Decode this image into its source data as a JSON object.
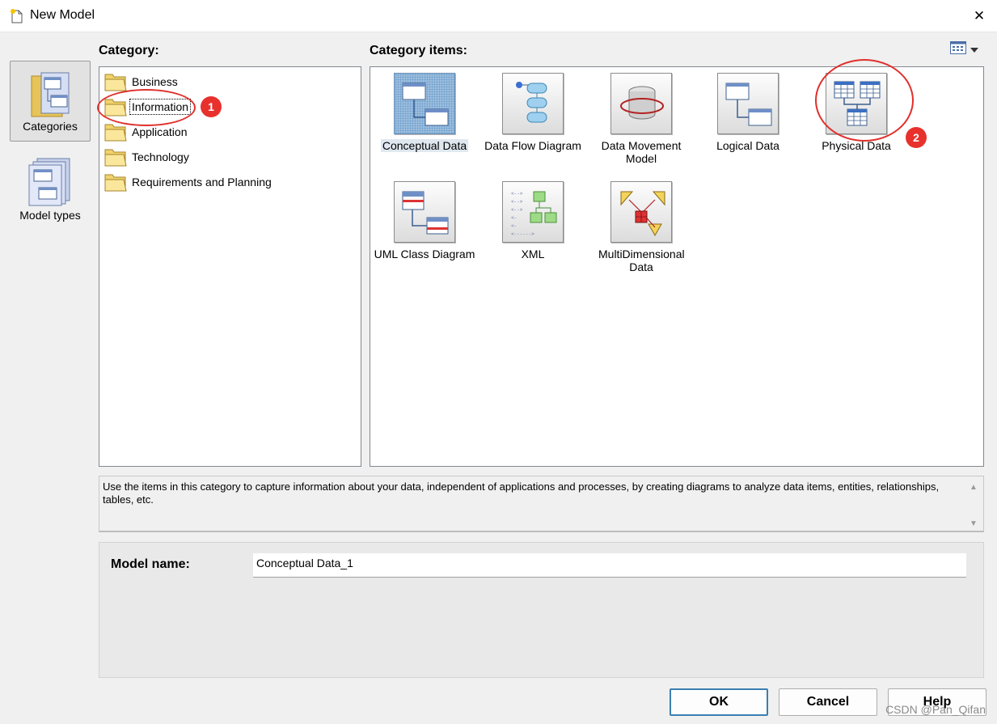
{
  "window": {
    "title": "New Model",
    "close_glyph": "✕"
  },
  "nav": {
    "categories_label": "Categories",
    "model_types_label": "Model types"
  },
  "category": {
    "header": "Category:",
    "items": [
      {
        "label": "Business"
      },
      {
        "label": "Information"
      },
      {
        "label": "Application"
      },
      {
        "label": "Technology"
      },
      {
        "label": "Requirements and Planning"
      }
    ]
  },
  "category_items": {
    "header": "Category items:",
    "items": [
      {
        "label": "Conceptual Data"
      },
      {
        "label": "Data Flow Diagram"
      },
      {
        "label": "Data Movement Model"
      },
      {
        "label": "Logical Data"
      },
      {
        "label": "Physical Data"
      },
      {
        "label": "UML Class Diagram"
      },
      {
        "label": "XML"
      },
      {
        "label": "MultiDimensional Data"
      }
    ]
  },
  "description": {
    "text": "Use the items in this category to capture information about your data, independent of applications and processes, by creating diagrams to analyze data items, entities, relationships, tables, etc.",
    "scroll_up": "▲",
    "scroll_down": "▼"
  },
  "model_name": {
    "label": "Model name:",
    "value": "Conceptual Data_1"
  },
  "buttons": {
    "ok": "OK",
    "cancel": "Cancel",
    "help": "Help"
  },
  "watermark": "CSDN @Pan_Qifan",
  "annotations": {
    "one": "1",
    "two": "2"
  },
  "colors": {
    "annotation": "#e0302c",
    "selection": "#a5c5e2"
  }
}
